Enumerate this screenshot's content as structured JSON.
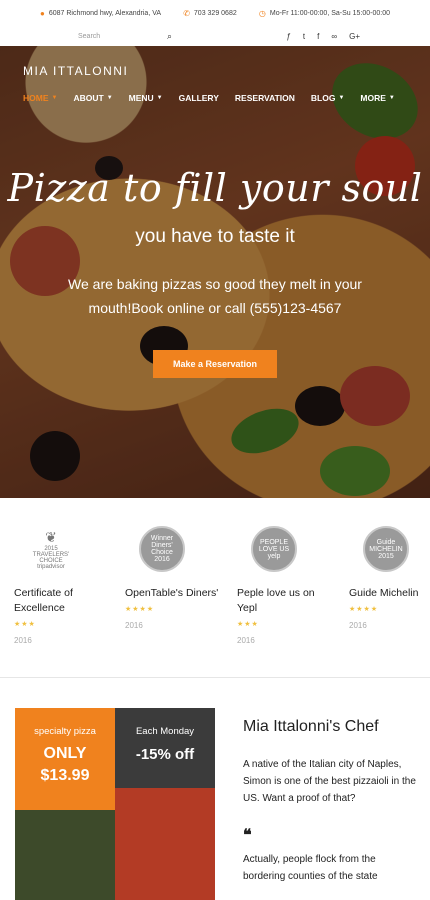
{
  "topbar": {
    "address": "6087 Richmond hwy, Alexandria, VA",
    "phone": "703 329 0682",
    "hours": "Mo-Fr 11:00-00:00, Sa-Su 15:00-00:00"
  },
  "search": {
    "placeholder": "Search"
  },
  "social": [
    "foursquare-icon",
    "twitter-icon",
    "facebook-icon",
    "tripadvisor-icon",
    "google-plus-icon"
  ],
  "brand": "MIA ITTALONNI",
  "nav": {
    "items": [
      "HOME",
      "ABOUT",
      "MENU",
      "GALLERY",
      "RESERVATION",
      "BLOG",
      "MORE"
    ]
  },
  "hero": {
    "title": "Pizza to fill your soul",
    "subtitle": "you have to taste it",
    "description": "We are baking pizzas so good they melt in your mouth!Book online or call (555)123-4567",
    "cta": "Make a Reservation"
  },
  "awards": [
    {
      "seal": "2015 TRAVELERS' CHOICE tripadvisor",
      "title": "Certificate of Excellence",
      "stars": "★★★",
      "year": "2016"
    },
    {
      "seal": "Winner Diners' Choice 2016",
      "title": "OpenTable's Diners'",
      "stars": "★★★★",
      "year": "2016"
    },
    {
      "seal": "PEOPLE LOVE US yelp",
      "title": "Peple love us on Yepl",
      "stars": "★★★",
      "year": "2016"
    },
    {
      "seal": "Guide MICHELIN 2015",
      "title": "Guide Michelin",
      "stars": "★★★★",
      "year": "2016"
    }
  ],
  "promo": {
    "tile1": {
      "line1": "specialty pizza",
      "line2": "ONLY",
      "line3": "$13.99"
    },
    "tile2": {
      "line1": "Each Monday",
      "line2": "-15% off"
    }
  },
  "chef": {
    "title": "Mia Ittalonni's Chef",
    "text": "A native of the Italian city of Naples, Simon is one of the best pizzaioli in the US. Want a proof of that?",
    "quote_mark": "❝",
    "quote": "Actually, people flock from the bordering counties of the state"
  },
  "colors": {
    "accent": "#f0821e"
  }
}
